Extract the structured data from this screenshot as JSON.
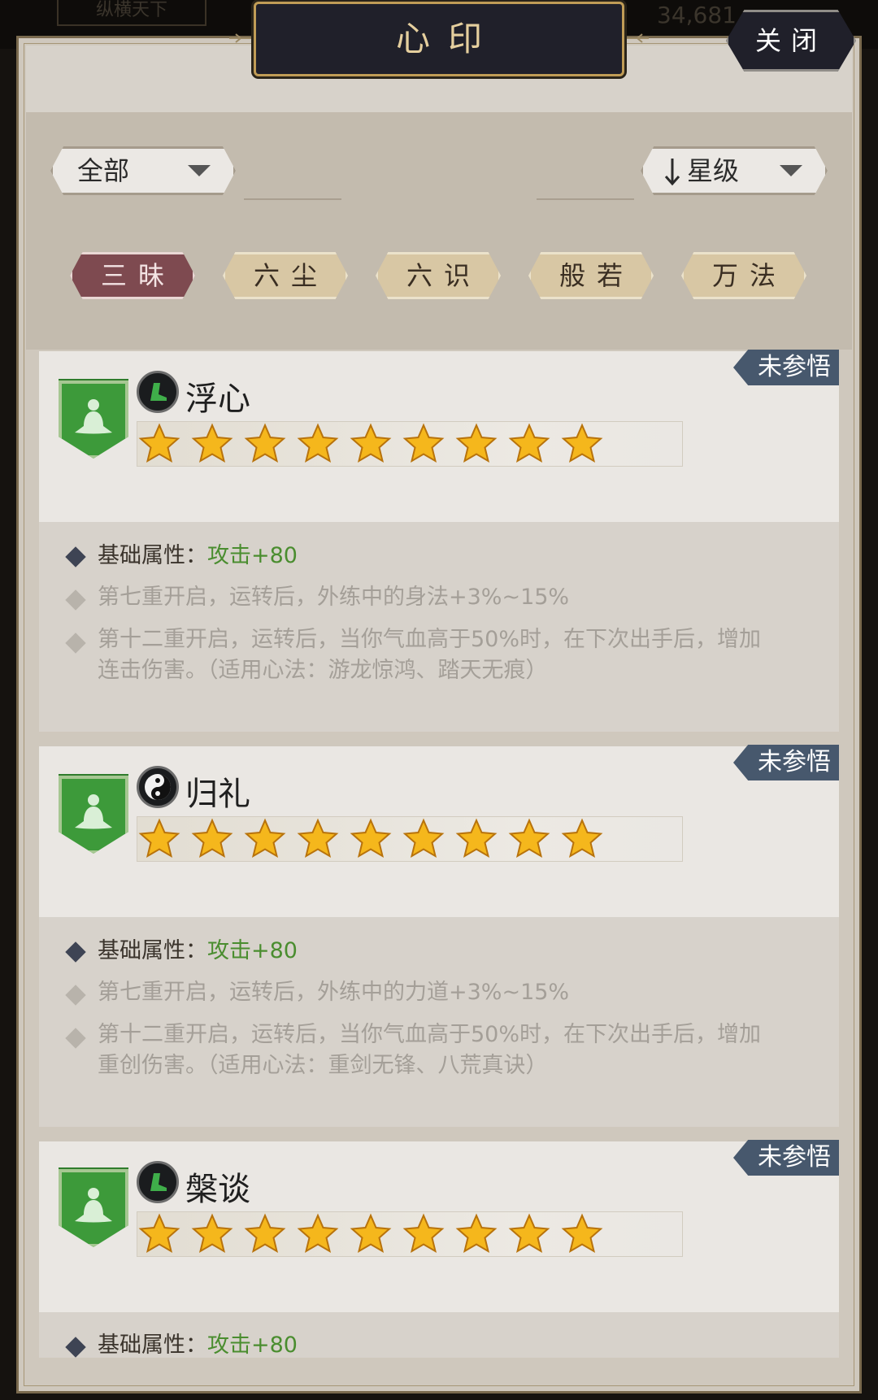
{
  "header": {
    "title": "心印",
    "close_label": "关闭",
    "background_label": "纵横天下",
    "background_number": "34,681"
  },
  "filters": {
    "category_dropdown": "全部",
    "sort_dropdown": "星级",
    "sort_icon": "arrow-down-icon"
  },
  "tabs": [
    {
      "label": "三昧",
      "active": true
    },
    {
      "label": "六尘",
      "active": false
    },
    {
      "label": "六识",
      "active": false
    },
    {
      "label": "般若",
      "active": false
    },
    {
      "label": "万法",
      "active": false
    }
  ],
  "cards": [
    {
      "name": "浮心",
      "type_icon": "boot-icon",
      "status": "未参悟",
      "star_count": 9,
      "base_label": "基础属性：",
      "base_value": "攻击+80",
      "effects": [
        "第七重开启，运转后，外练中的身法+3%~15%",
        "第十二重开启，运转后，当你气血高于50%时，在下次出手后，增加连击伤害。（适用心法：游龙惊鸿、踏天无痕）"
      ]
    },
    {
      "name": "归礼",
      "type_icon": "yin-yang-icon",
      "status": "未参悟",
      "star_count": 9,
      "base_label": "基础属性：",
      "base_value": "攻击+80",
      "effects": [
        "第七重开启，运转后，外练中的力道+3%~15%",
        "第十二重开启，运转后，当你气血高于50%时，在下次出手后，增加重创伤害。（适用心法：重剑无锋、八荒真诀）"
      ]
    },
    {
      "name": "槃谈",
      "type_icon": "boot-icon",
      "status": "未参悟",
      "star_count": 9,
      "base_label": "基础属性：",
      "base_value": "攻击+80",
      "effects": []
    }
  ],
  "colors": {
    "active_tab": "#7e4a50",
    "inactive_tab": "#d8c7a4",
    "badge_green": "#3d9a3a",
    "status_ribbon": "#47586d",
    "value_green": "#4a8d2f",
    "star_gold": "#f5b71c"
  }
}
